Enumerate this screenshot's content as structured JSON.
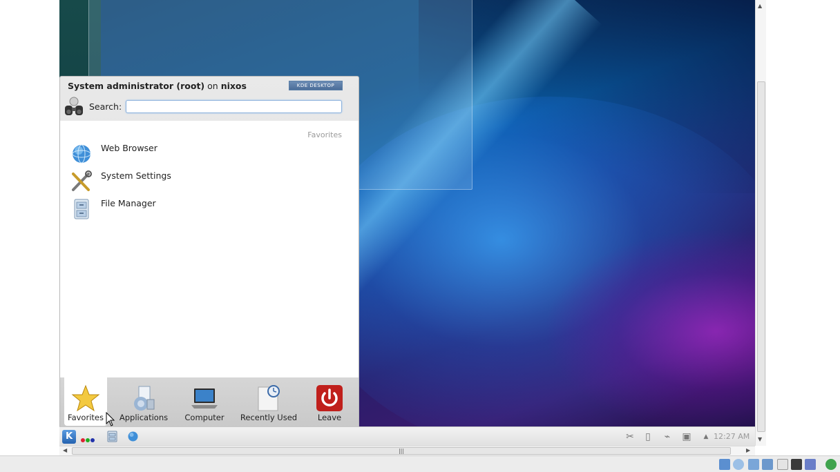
{
  "menu": {
    "user_name": "System administrator (root)",
    "on_word": "on",
    "host": "nixos",
    "badge": "KDE DESKTOP",
    "search_label": "Search:",
    "search_value": "",
    "section_title": "Favorites",
    "items": [
      {
        "label": "Web Browser",
        "icon": "globe-icon"
      },
      {
        "label": "System Settings",
        "icon": "tools-icon"
      },
      {
        "label": "File Manager",
        "icon": "file-cabinet-icon"
      }
    ],
    "tabs": [
      {
        "label": "Favorites",
        "icon": "star-icon",
        "active": true
      },
      {
        "label": "Applications",
        "icon": "applications-icon"
      },
      {
        "label": "Computer",
        "icon": "laptop-icon"
      },
      {
        "label": "Recently Used",
        "icon": "clock-document-icon"
      },
      {
        "label": "Leave",
        "icon": "power-icon"
      }
    ]
  },
  "panel": {
    "clock": "12:27 AM"
  },
  "colors": {
    "accent": "#2563b0",
    "leave_red": "#c0201c"
  }
}
